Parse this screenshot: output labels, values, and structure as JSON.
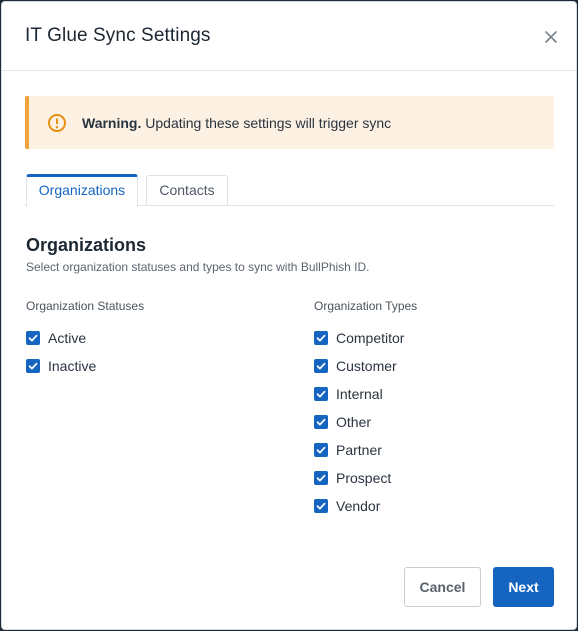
{
  "dialog": {
    "title": "IT Glue Sync Settings",
    "close_icon": "close-icon"
  },
  "warning": {
    "icon": "warning-icon",
    "bold": "Warning.",
    "text": " Updating these settings will trigger sync"
  },
  "tabs": [
    {
      "label": "Organizations",
      "active": true
    },
    {
      "label": "Contacts",
      "active": false
    }
  ],
  "section": {
    "title": "Organizations",
    "subtitle": "Select organization statuses and types to sync with BullPhish ID."
  },
  "statuses": {
    "label": "Organization Statuses",
    "items": [
      {
        "label": "Active",
        "checked": true
      },
      {
        "label": "Inactive",
        "checked": true
      }
    ]
  },
  "types": {
    "label": "Organization Types",
    "items": [
      {
        "label": "Competitor",
        "checked": true
      },
      {
        "label": "Customer",
        "checked": true
      },
      {
        "label": "Internal",
        "checked": true
      },
      {
        "label": "Other",
        "checked": true
      },
      {
        "label": "Partner",
        "checked": true
      },
      {
        "label": "Prospect",
        "checked": true
      },
      {
        "label": "Vendor",
        "checked": true
      }
    ]
  },
  "buttons": {
    "cancel": "Cancel",
    "next": "Next"
  },
  "colors": {
    "accent": "#1565c0",
    "warning_bg": "#fcf1e2",
    "warning_border": "#f2a33a"
  }
}
